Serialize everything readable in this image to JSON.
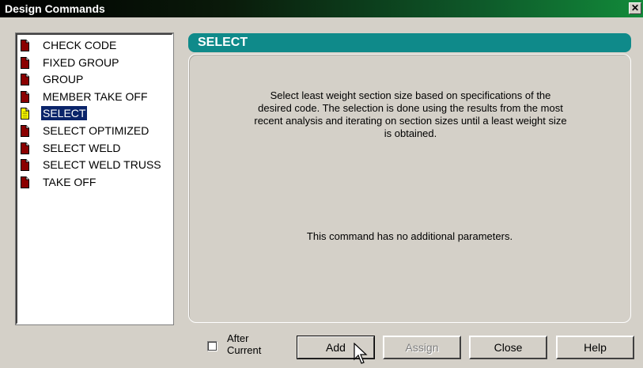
{
  "window": {
    "title": "Design Commands",
    "close_glyph": "✕"
  },
  "command_list": {
    "items": [
      {
        "label": "CHECK CODE",
        "icon": "document-icon",
        "selected": false
      },
      {
        "label": "FIXED GROUP",
        "icon": "document-icon",
        "selected": false
      },
      {
        "label": "GROUP",
        "icon": "document-icon",
        "selected": false
      },
      {
        "label": "MEMBER TAKE OFF",
        "icon": "document-icon",
        "selected": false
      },
      {
        "label": "SELECT",
        "icon": "document-yellow-icon",
        "selected": true
      },
      {
        "label": "SELECT OPTIMIZED",
        "icon": "document-icon",
        "selected": false
      },
      {
        "label": "SELECT WELD",
        "icon": "document-icon",
        "selected": false
      },
      {
        "label": "SELECT WELD TRUSS",
        "icon": "document-icon",
        "selected": false
      },
      {
        "label": "TAKE OFF",
        "icon": "document-icon",
        "selected": false
      }
    ]
  },
  "panel": {
    "title": "SELECT",
    "description": "Select least weight section size based on specifications of the desired code. The selection is done using the results from the most recent analysis and iterating on section sizes until a least weight size is obtained.",
    "no_params_text": "This command has no additional parameters."
  },
  "footer": {
    "after_current_line1": "After",
    "after_current_line2": "Current",
    "after_current_checked": false,
    "add_label": "Add",
    "assign_label": "Assign",
    "close_label": "Close",
    "help_label": "Help"
  },
  "colors": {
    "header_teal": "#0f8a8a",
    "selection": "#0a246a",
    "doc_red": "#8b0000",
    "doc_yellow": "#ffff00",
    "dialog_bg": "#d4d0c8"
  }
}
